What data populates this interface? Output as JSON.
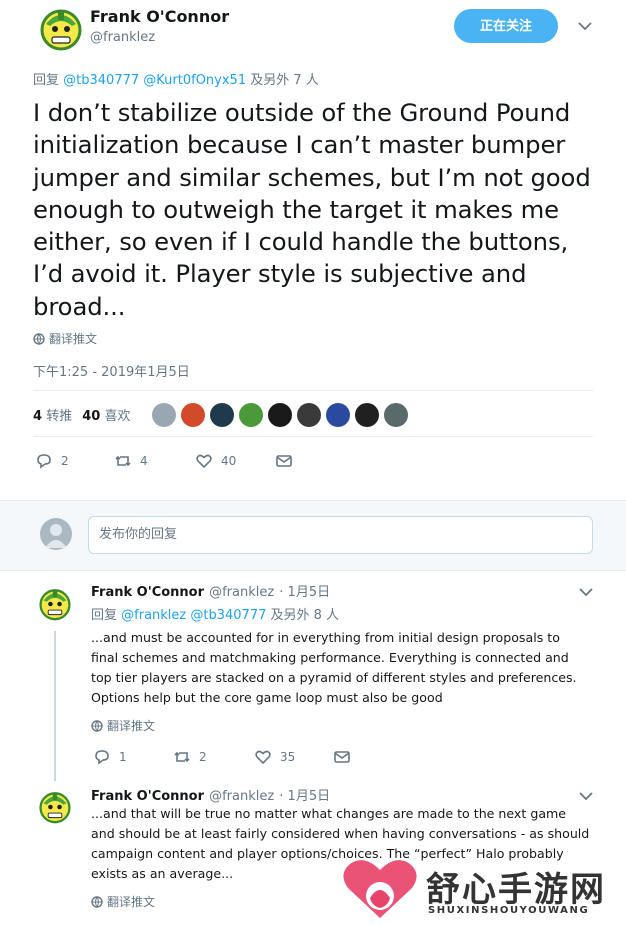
{
  "main_tweet": {
    "author_name": "Frank O'Connor",
    "author_handle": "@franklez",
    "follow_label": "正在关注",
    "reply_prefix": "回复",
    "reply_mention_1": "@tb340777",
    "reply_mention_2": "@Kurt0fOnyx51",
    "reply_suffix": "及另外 7 人",
    "text": "I don’t stabilize outside of the Ground Pound initialization because I can’t master bumper jumper and similar schemes, but I’m not good enough to outweigh the target it makes me either, so even if I could handle the buttons, I’d avoid it. Player style is subjective and broad...",
    "translate_label": "翻译推文",
    "timestamp": "下午1:25 - 2019年1月5日",
    "retweets_count": "4",
    "retweets_label": "转推",
    "likes_count": "40",
    "likes_label": "喜欢",
    "likers": [
      "#9aa7b3",
      "#d24a2a",
      "#1f3a4a",
      "#4a9a3a",
      "#1a1a1a",
      "#3a3a3a",
      "#2a4aa0",
      "#202020",
      "#5a6a6a"
    ],
    "actions": {
      "reply": "2",
      "retweet": "4",
      "like": "40"
    }
  },
  "reply_box": {
    "placeholder": "发布你的回复"
  },
  "replies": [
    {
      "author_name": "Frank O'Connor",
      "author_handle": "@franklez",
      "date": "· 1月5日",
      "reply_prefix": "回复",
      "reply_mention_1": "@franklez",
      "reply_mention_2": "@tb340777",
      "reply_suffix": "及另外 8 人",
      "text": "...and must be accounted for in everything from initial design proposals to final schemes and matchmaking performance. Everything is connected and top tier players are stacked on a pyramid of different styles and preferences. Options help but the core game loop must also be good",
      "translate_label": "翻译推文",
      "actions": {
        "reply": "1",
        "retweet": "2",
        "like": "35"
      }
    },
    {
      "author_name": "Frank O'Connor",
      "author_handle": "@franklez",
      "date": "· 1月5日",
      "text": "...and that will be true no matter what changes are made to the next game and should be at least fairly considered when having conversations - as should campaign content and player options/choices. The “perfect” Halo probably exists as an average...",
      "translate_label": "翻译推文"
    }
  ],
  "watermark": {
    "title": "舒心手游网",
    "subtitle": "SHUXINSHOUYOUWANG"
  },
  "colors": {
    "accent": "#1da1f2",
    "follow_bg": "#4ab3f4",
    "muted": "#657786"
  },
  "icons": [
    "avatar-icon",
    "chevron-down-icon",
    "globe-icon",
    "reply-icon",
    "retweet-icon",
    "like-icon",
    "dm-icon",
    "heart-logo-icon"
  ]
}
